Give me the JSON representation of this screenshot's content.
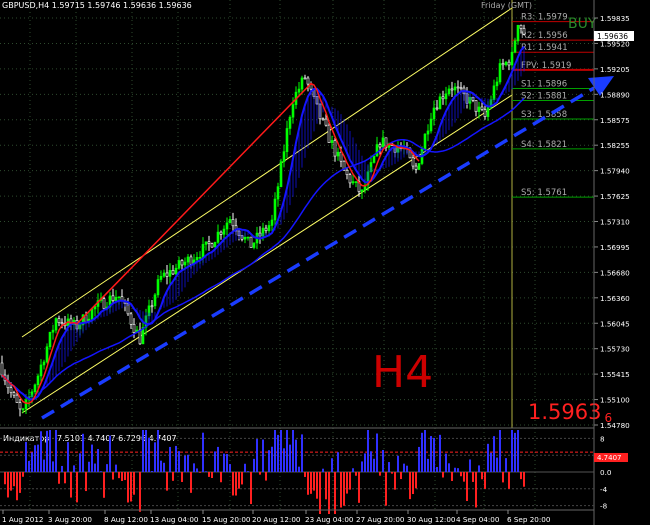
{
  "header": {
    "symbol_info": "GBPUSD,H4  1.59715 1.59746 1.59636 1.59636",
    "session_label": "Friday  (GMT)",
    "signal": "BUY",
    "timeframe_watermark": "H4",
    "big_price_main": "1.5963",
    "big_price_sub": "6"
  },
  "colors": {
    "background": "#000000",
    "bull_candle": "#00ff00",
    "bear_candle": "#ffffff",
    "ma_blue": "#1515ff",
    "ma_red": "#ff1a1a",
    "channel": "#ffff66",
    "trend_arrow": "#1a3cff",
    "level_line": "#00a000",
    "resistance_line": "#c00000",
    "grid": "#3a5a3a",
    "axis_text": "#ffffff",
    "watermark": "#cc0000",
    "osc_bull": "#3030ff",
    "osc_bear": "#ff2020"
  },
  "current_price_label": "1.59636",
  "price_axis": {
    "ticks": [
      "1.59835",
      "1.59520",
      "1.59205",
      "1.58890",
      "1.58575",
      "1.58255",
      "1.57940",
      "1.57625",
      "1.57310",
      "1.56995",
      "1.56680",
      "1.56360",
      "1.56045",
      "1.55730",
      "1.55415",
      "1.55100",
      "1.54780"
    ]
  },
  "time_axis": {
    "ticks": [
      "1 Aug 2012",
      "3 Aug 20:00",
      "8 Aug 12:00",
      "13 Aug 04:00",
      "15 Aug 20:00",
      "20 Aug 12:00",
      "23 Aug 04:00",
      "27 Aug 20:00",
      "30 Aug 12:00",
      "4 Sep 04:00",
      "6 Sep 20:00"
    ]
  },
  "pivot_levels": [
    {
      "label": "R3: 1.5979",
      "price": 1.5979,
      "kind": "resistance"
    },
    {
      "label": "R2: 1.5956",
      "price": 1.5956,
      "kind": "resistance"
    },
    {
      "label": "R1: 1.5941",
      "price": 1.5941,
      "kind": "resistance"
    },
    {
      "label": "FPV: 1.5919",
      "price": 1.5919,
      "kind": "pivot"
    },
    {
      "label": "S1: 1.5896",
      "price": 1.5896,
      "kind": "support"
    },
    {
      "label": "S2: 1.5881",
      "price": 1.5881,
      "kind": "support"
    },
    {
      "label": "S3: 1.5858",
      "price": 1.5858,
      "kind": "support"
    },
    {
      "label": "S4: 1.5821",
      "price": 1.5821,
      "kind": "support"
    },
    {
      "label": "S5: 1.5761",
      "price": 1.5761,
      "kind": "support"
    }
  ],
  "indicator_panel": {
    "title": "Индикатор",
    "values": "7.5101 4.7407 6.7296 4.7407",
    "current_label": "4.7407",
    "ticks": [
      "8",
      "4",
      "0.0",
      "-4",
      "-8"
    ]
  }
}
